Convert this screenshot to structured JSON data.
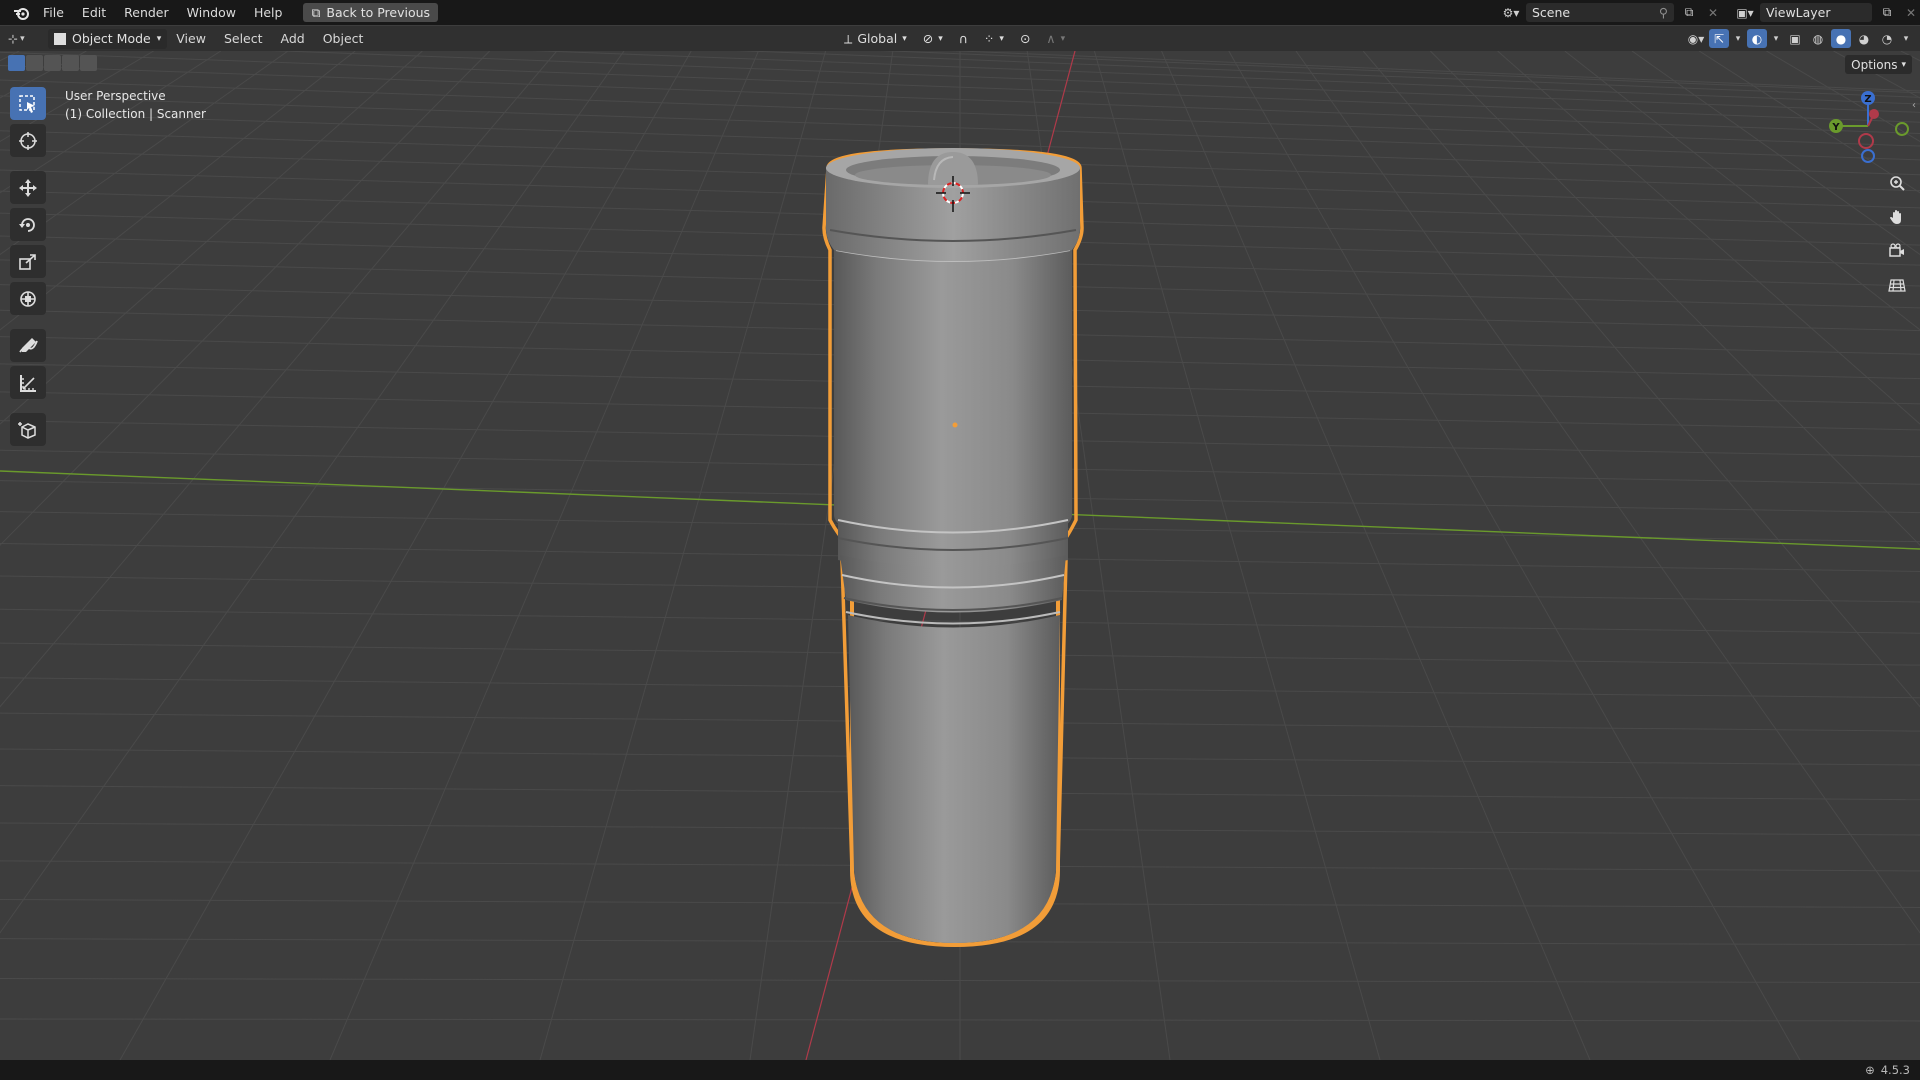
{
  "topbar": {
    "menus": [
      "File",
      "Edit",
      "Render",
      "Window",
      "Help"
    ],
    "back_button": "Back to Previous",
    "scene": "Scene",
    "view_layer": "ViewLayer"
  },
  "header": {
    "mode": "Object Mode",
    "menus": [
      "View",
      "Select",
      "Add",
      "Object"
    ],
    "transform_orientation": "Global",
    "options": "Options"
  },
  "viewport": {
    "view_name": "User Perspective",
    "collection_info": "(1) Collection | Scanner",
    "object_name": "Scanner",
    "selection_outline_color": "#f29d38",
    "x_axis_color": "#b03a4a",
    "y_axis_color": "#6a9a2c",
    "gizmo": {
      "z_label": "Z",
      "y_label": "Y"
    }
  },
  "toolbar": {
    "tools": [
      "select-box",
      "cursor",
      "move",
      "rotate",
      "scale",
      "transform",
      "annotate",
      "measure",
      "add-cube"
    ]
  },
  "statusbar": {
    "version": "4.5.3"
  }
}
